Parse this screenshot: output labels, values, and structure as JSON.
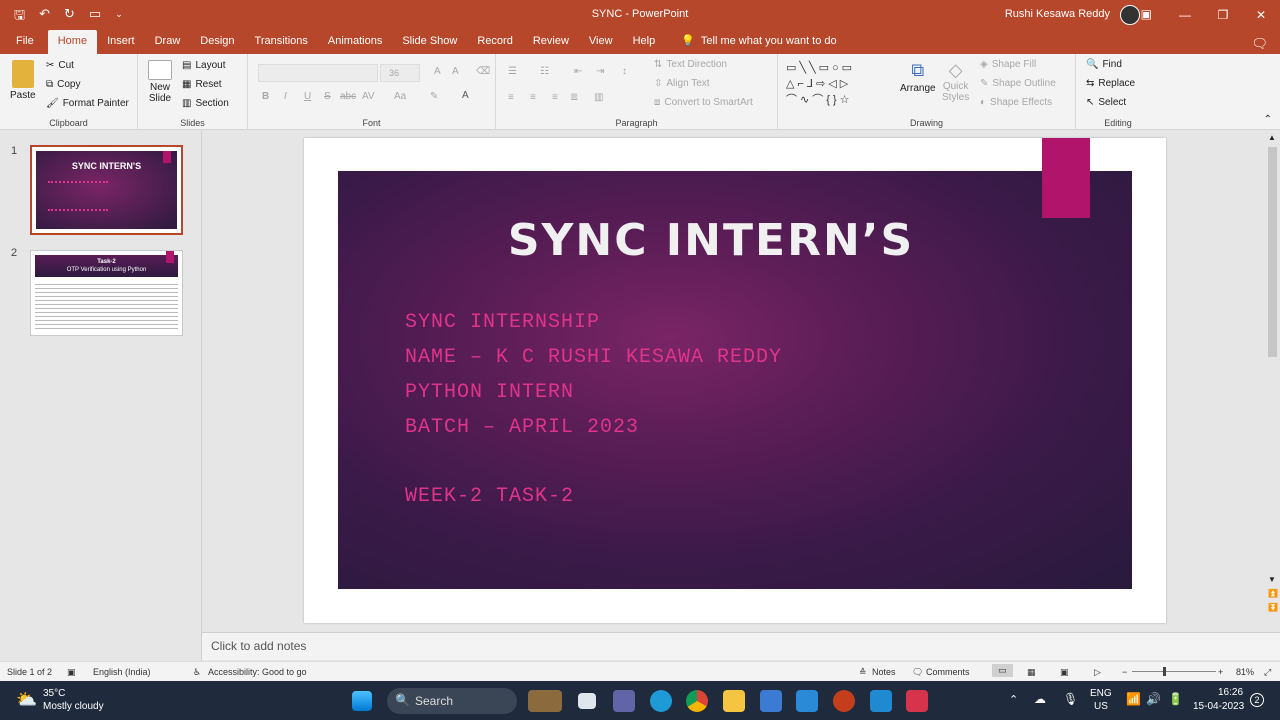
{
  "titlebar": {
    "title": "SYNC  -  PowerPoint",
    "user": "Rushi Kesawa Reddy",
    "minimize": "—",
    "restore": "❐",
    "close": "✕"
  },
  "tabs": [
    "File",
    "Home",
    "Insert",
    "Draw",
    "Design",
    "Transitions",
    "Animations",
    "Slide Show",
    "Record",
    "Review",
    "View",
    "Help"
  ],
  "tellme": "Tell me what you want to do",
  "ribbon": {
    "clipboard": {
      "label": "Clipboard",
      "paste": "Paste",
      "cut": "Cut",
      "copy": "Copy",
      "format_painter": "Format Painter"
    },
    "slides": {
      "label": "Slides",
      "new_slide_1": "New",
      "new_slide_2": "Slide",
      "layout": "Layout",
      "reset": "Reset",
      "section": "Section"
    },
    "font": {
      "label": "Font",
      "size": "36",
      "bold": "B",
      "italic": "I",
      "underline": "U",
      "strike": "S",
      "shadow": "abc"
    },
    "paragraph": {
      "label": "Paragraph",
      "text_direction": "Text Direction",
      "align_text": "Align Text",
      "convert_smartart": "Convert to SmartArt"
    },
    "drawing": {
      "label": "Drawing",
      "arrange": "Arrange",
      "quick_styles_1": "Quick",
      "quick_styles_2": "Styles",
      "shape_fill": "Shape Fill",
      "shape_outline": "Shape Outline",
      "shape_effects": "Shape Effects"
    },
    "editing": {
      "label": "Editing",
      "find": "Find",
      "replace": "Replace",
      "select": "Select"
    }
  },
  "thumbnails": [
    {
      "num": "1",
      "title": "SYNC INTERN'S"
    },
    {
      "num": "2",
      "title": "Task-2",
      "subtitle": "OTP Verification using Python"
    }
  ],
  "slide": {
    "title": "SYNC INTERN’S",
    "lines": [
      "SYNC INTERNSHIP",
      "NAME – K C RUSHI KESAWA REDDY",
      "PYTHON INTERN",
      "BATCH – APRIL 2023",
      "WEEK-2 TASK-2"
    ]
  },
  "notes_placeholder": "Click to add notes",
  "status": {
    "slide_of": "Slide 1 of 2",
    "language": "English (India)",
    "accessibility": "Accessibility: Good to go",
    "notes": "Notes",
    "comments": "Comments",
    "zoom": "81%"
  },
  "taskbar": {
    "temp": "35°C",
    "weather": "Mostly cloudy",
    "search": "Search",
    "lang_1": "ENG",
    "lang_2": "US",
    "time": "16:26",
    "date": "15-04-2023",
    "notif_count": "2"
  },
  "colors": {
    "accent": "#b7472a",
    "slide_text": "#e0348a",
    "pink_tab": "#b0146b"
  }
}
